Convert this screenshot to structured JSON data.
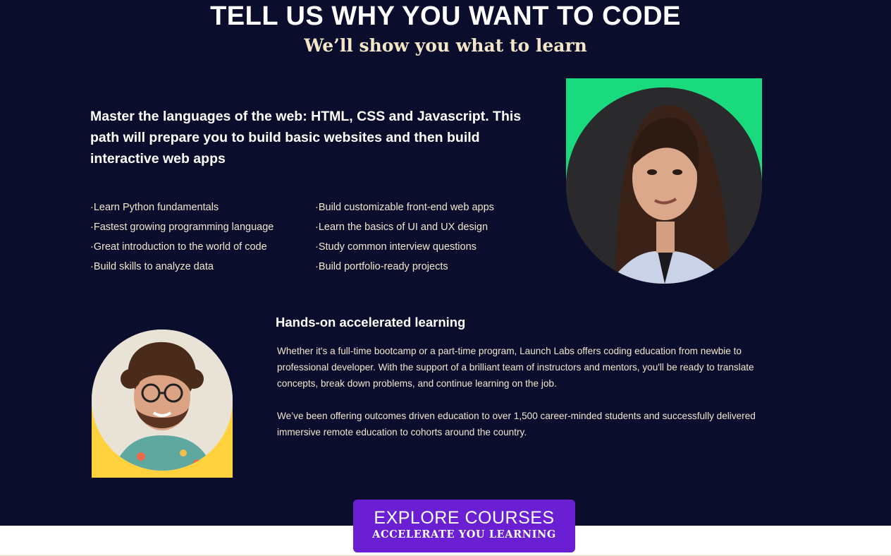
{
  "hero": {
    "title": "TELL US WHY YOU WANT TO CODE",
    "subtitle": "We’ll show you what to learn"
  },
  "path": {
    "description": "Master the languages of the web: HTML, CSS and Javascript. This path will prepare you to build basic websites and then build interactive web apps",
    "features_left": [
      "Learn Python fundamentals",
      "Fastest growing programming language",
      "Great introduction to the world of code",
      "Build skills to analyze data"
    ],
    "features_right": [
      "Build customizable front-end web apps",
      "Learn the basics of UI and UX design",
      "Study common interview questions",
      "Build portfolio-ready projects"
    ]
  },
  "hands_on": {
    "title": "Hands-on accelerated learning",
    "paragraph_1": "Whether it's a full-time bootcamp or a part-time program, Launch Labs offers coding education from newbie to professional developer. With the support of a brilliant team of instructors and mentors, you'll be ready to translate concepts, break down problems, and continue learning on the job.",
    "paragraph_2": "We’ve been offering outcomes driven education to over 1,500 career-minded students and successfully delivered immersive remote education to cohorts around the country."
  },
  "cta": {
    "label": "EXPLORE COURSES",
    "sublabel": "ACCELERATE YOU LEARNING"
  },
  "colors": {
    "background": "#0b0d2c",
    "accent_green": "#19db7e",
    "accent_yellow": "#ffd23d",
    "button_purple": "#6b1fd2",
    "cream_text": "#f1e7cf"
  }
}
